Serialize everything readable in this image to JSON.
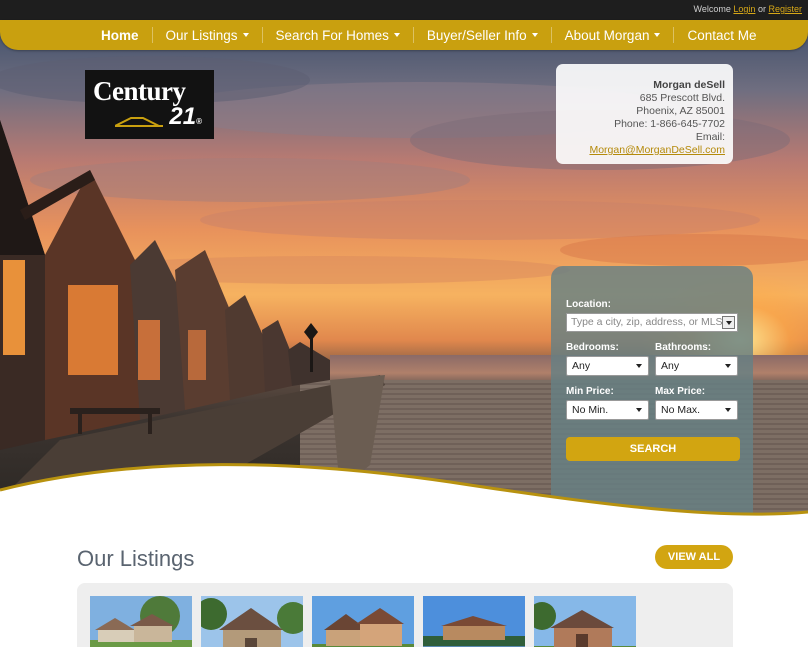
{
  "topbar": {
    "welcome_text": "Welcome",
    "login_label": "Login",
    "or_text": "or",
    "register_label": "Register"
  },
  "nav": {
    "items": [
      {
        "label": "Home",
        "active": true,
        "dropdown": false
      },
      {
        "label": "Our Listings",
        "active": false,
        "dropdown": true
      },
      {
        "label": "Search For Homes",
        "active": false,
        "dropdown": true
      },
      {
        "label": "Buyer/Seller Info",
        "active": false,
        "dropdown": true
      },
      {
        "label": "About Morgan",
        "active": false,
        "dropdown": true
      },
      {
        "label": "Contact Me",
        "active": false,
        "dropdown": false
      }
    ]
  },
  "logo": {
    "word": "Century",
    "number": "21",
    "mark": "®"
  },
  "agent": {
    "name": "Morgan deSell",
    "street": "685 Prescott Blvd.",
    "city": "Phoenix, AZ 85001",
    "phone": "Phone: 1-866-645-7702",
    "email_label": "Email:",
    "email": "Morgan@MorganDeSell.com"
  },
  "search": {
    "location_label": "Location:",
    "location_placeholder": "Type a city, zip, address, or MLS",
    "bedrooms_label": "Bedrooms:",
    "bedrooms_value": "Any",
    "bathrooms_label": "Bathrooms:",
    "bathrooms_value": "Any",
    "min_price_label": "Min Price:",
    "min_price_value": "No Min.",
    "max_price_label": "Max Price:",
    "max_price_value": "No Max.",
    "button_label": "SEARCH"
  },
  "listings": {
    "title": "Our Listings",
    "view_all_label": "VIEW ALL"
  },
  "colors": {
    "gold": "#d2a511",
    "nav_gold": "#c9a00f",
    "panel_teal": "#66808480"
  }
}
